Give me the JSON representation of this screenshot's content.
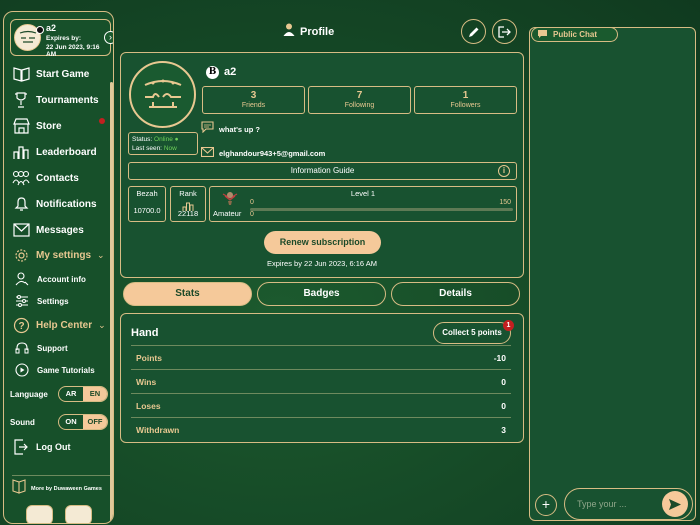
{
  "user": {
    "name": "a2",
    "expires_label": "Expires by:",
    "expires_date": "22 Jun 2023, 9:16 AM"
  },
  "nav": {
    "start_game": "Start Game",
    "tournaments": "Tournaments",
    "store": "Store",
    "leaderboard": "Leaderboard",
    "contacts": "Contacts",
    "notifications": "Notifications",
    "messages": "Messages",
    "my_settings": "My settings",
    "account_info": "Account info",
    "settings": "Settings",
    "help_center": "Help Center",
    "support": "Support",
    "game_tutorials": "Game Tutorials",
    "language_label": "Language",
    "language_ar": "AR",
    "language_en": "EN",
    "sound_label": "Sound",
    "sound_on": "ON",
    "sound_off": "OFF",
    "log_out": "Log Out",
    "more_by": "More by Duwaween Games"
  },
  "header": {
    "title": "Profile"
  },
  "profile": {
    "badge_letter": "B",
    "name": "a2",
    "friends_count": "3",
    "friends_label": "Friends",
    "following_count": "7",
    "following_label": "Following",
    "followers_count": "1",
    "followers_label": "Followers",
    "status_label": "Status:",
    "status_value": "Online",
    "last_seen_label": "Last seen:",
    "last_seen_value": "Now",
    "whats_up": "what's up ?",
    "email": "elghandour943+5@gmail.com",
    "info_guide": "Information Guide",
    "bezah_label": "Bezah",
    "bezah_value": "10700.0",
    "rank_label": "Rank",
    "rank_value": "22118",
    "rank_title": "Amateur",
    "level_label": "Level 1",
    "level_min": "0",
    "level_max": "150",
    "level_current": "0",
    "level_progress": 0,
    "renew_label": "Renew subscription",
    "expires_line": "Expires by 22 Jun 2023, 6:16 AM"
  },
  "tabs": [
    "Stats",
    "Badges",
    "Details"
  ],
  "hand": {
    "title": "Hand",
    "collect_label": "Collect 5 points",
    "collect_badge": "1",
    "rows": [
      {
        "label": "Points",
        "value": "-10"
      },
      {
        "label": "Wins",
        "value": "0"
      },
      {
        "label": "Loses",
        "value": "0"
      },
      {
        "label": "Withdrawn",
        "value": "3"
      }
    ]
  },
  "chat": {
    "tab_label": "Public Chat",
    "placeholder": "Type your ..."
  },
  "colors": {
    "accent": "#e8c891",
    "button_fill": "#f5c99a",
    "background": "#154826",
    "alert": "#c32020",
    "online": "#6fcf5a"
  }
}
